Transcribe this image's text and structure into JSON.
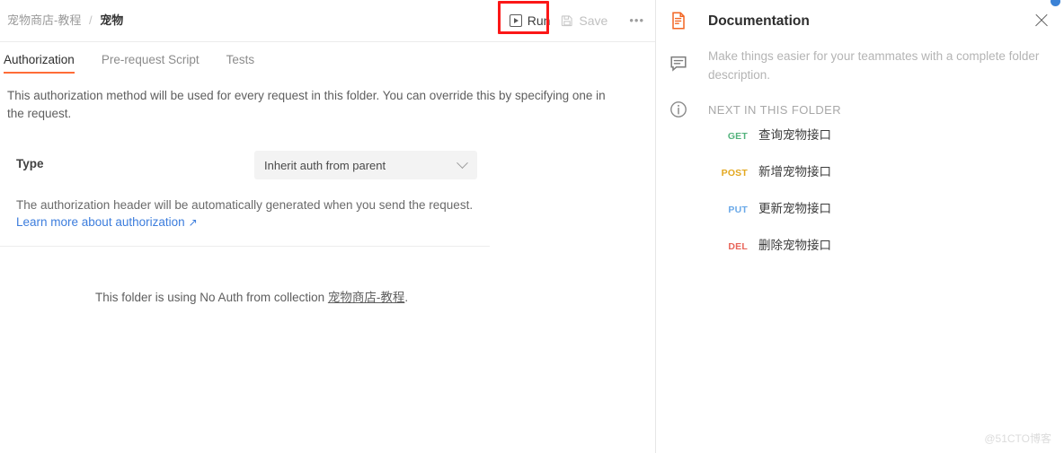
{
  "breadcrumb": {
    "collection": "宠物商店-教程",
    "separator": "/",
    "current": "宠物"
  },
  "toolbar": {
    "run_label": "Run",
    "save_label": "Save",
    "more_label": "•••",
    "run_icon": "play-icon",
    "save_icon": "floppy-disk-icon",
    "highlight_color": "#fb1717"
  },
  "tabs": [
    {
      "label": "Authorization",
      "active": true
    },
    {
      "label": "Pre-request Script",
      "active": false
    },
    {
      "label": "Tests",
      "active": false
    }
  ],
  "authorization": {
    "description": "This authorization method will be used for every request in this folder. You can override this by specifying one in the request.",
    "type_label": "Type",
    "type_value": "Inherit auth from parent",
    "note": "The authorization header will be automatically generated when you send the request.",
    "learn_more": "Learn more about authorization",
    "learn_more_icon": "↗",
    "inherit_prefix": "This folder is using No Auth from collection ",
    "inherit_collection": "宠物商店-教程",
    "inherit_suffix": ".",
    "accent_color": "#ff6c37",
    "link_color": "#3c7ddd"
  },
  "documentation": {
    "title": "Documentation",
    "description": "Make things easier for your teammates with a complete folder description.",
    "next_in_folder_label": "NEXT IN THIS FOLDER",
    "requests": [
      {
        "method": "GET",
        "name": "查询宠物接口",
        "color": "#52b37c"
      },
      {
        "method": "POST",
        "name": "新增宠物接口",
        "color": "#e3a820"
      },
      {
        "method": "PUT",
        "name": "更新宠物接口",
        "color": "#6aa9e8"
      },
      {
        "method": "DEL",
        "name": "删除宠物接口",
        "color": "#e8655a"
      }
    ],
    "icons": {
      "doc": "document-icon",
      "comment": "comment-icon",
      "info": "info-icon",
      "close": "close-icon"
    }
  },
  "watermark": "@51CTO博客"
}
